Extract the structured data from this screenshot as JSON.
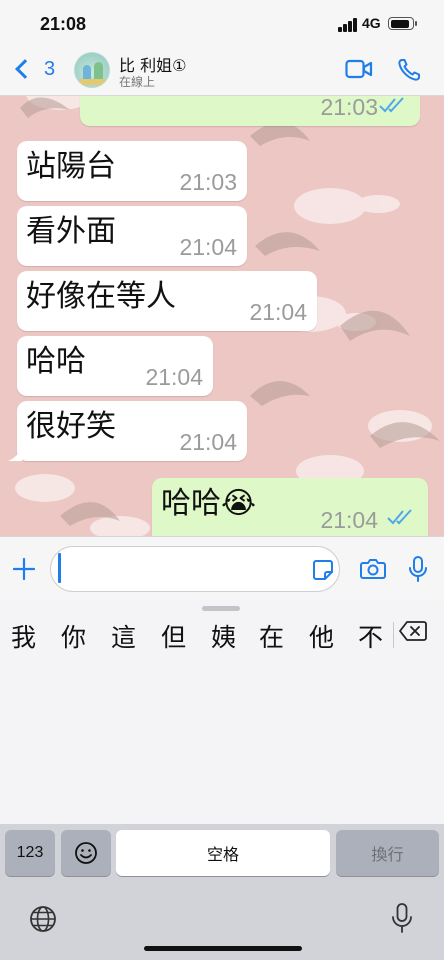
{
  "status": {
    "time": "21:08",
    "network": "4G",
    "battery": 0.85
  },
  "header": {
    "back_count": "3",
    "contact_name": "比 利姐①",
    "contact_status": "在線上"
  },
  "messages": [
    {
      "direction": "out",
      "text": "",
      "time": "21:03",
      "read": true,
      "partial": true
    },
    {
      "direction": "in",
      "text": "站陽台",
      "time": "21:03"
    },
    {
      "direction": "in",
      "text": "看外面",
      "time": "21:04"
    },
    {
      "direction": "in",
      "text": "好像在等人",
      "time": "21:04"
    },
    {
      "direction": "in",
      "text": "哈哈",
      "time": "21:04"
    },
    {
      "direction": "in",
      "text": "很好笑",
      "time": "21:04"
    },
    {
      "direction": "out",
      "text": "哈哈😭",
      "time": "21:04",
      "read": true
    }
  ],
  "input": {
    "value": "",
    "placeholder": ""
  },
  "keyboard": {
    "candidates": [
      "我",
      "你",
      "這",
      "但",
      "姨",
      "在",
      "他",
      "不"
    ],
    "key_123": "123",
    "space_label": "空格",
    "return_label": "換行"
  },
  "colors": {
    "accent": "#1f7ee8",
    "outgoing_bubble": "#dff8c7",
    "incoming_bubble": "#ffffff",
    "wallpaper": "#ecc7c3",
    "read_ticks": "#4fa8e8"
  },
  "icons": {
    "back": "chevron-left-icon",
    "video": "video-camera-icon",
    "call": "phone-icon",
    "plus": "plus-icon",
    "sticker": "sticker-icon",
    "camera": "camera-icon",
    "mic": "microphone-icon",
    "delete": "backspace-icon",
    "emoji": "emoji-icon",
    "globe": "globe-icon"
  }
}
